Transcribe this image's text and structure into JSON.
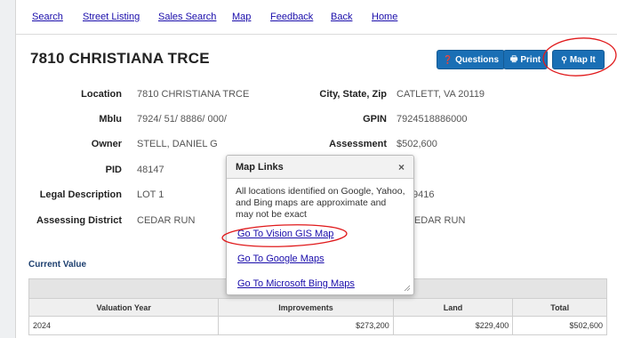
{
  "nav": {
    "links": [
      "Search",
      "Street Listing",
      "Sales Search",
      "Map",
      "Feedback",
      "Back",
      "Home"
    ]
  },
  "title": "7810 CHRISTIANA TRCE",
  "buttons": {
    "questions": "Questions",
    "print": "Print",
    "map_it": "Map It"
  },
  "details": {
    "location_label": "Location",
    "location_value": "7810 CHRISTIANA TRCE",
    "csz_label": "City, State, Zip",
    "csz_value": "CATLETT, VA 20119",
    "mblu_label": "Mblu",
    "mblu_value": "7924/ 51/ 8886/ 000/",
    "gpin_label": "GPIN",
    "gpin_value": "7924518886000",
    "owner_label": "Owner",
    "owner_value": "STELL, DANIEL G",
    "assessment_label": "Assessment",
    "assessment_value": "$502,600",
    "pid_label": "PID",
    "pid_value": "48147",
    "legal_label": "Legal Description",
    "legal_value": "LOT 1",
    "legal_right_partial": "9416",
    "district_label": "Assessing District",
    "district_value": "CEDAR RUN",
    "district_right_partial": "CEDAR RUN"
  },
  "current_value": {
    "title": "Current Value",
    "headers": [
      "Valuation Year",
      "Improvements",
      "Land",
      "Total"
    ],
    "rows": [
      {
        "year": "2024",
        "improvements": "$273,200",
        "land": "$229,400",
        "total": "$502,600"
      }
    ]
  },
  "popup": {
    "title": "Map Links",
    "close": "×",
    "message": "All locations identified on Google, Yahoo, and Bing maps are approximate and may not be exact",
    "links": [
      "Go To Vision GIS Map",
      "Go To Google Maps",
      "Go To Microsoft Bing Maps"
    ]
  },
  "colors": {
    "button_blue": "#1a6fb5",
    "annotation_red": "#e0191b",
    "link_blue": "#1a0dab"
  }
}
